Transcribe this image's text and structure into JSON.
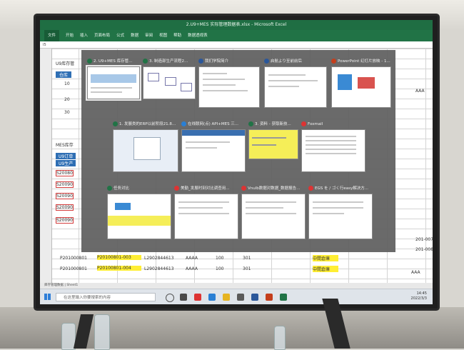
{
  "excel": {
    "title": "2.U9+MES 实际管理数据表.xlsx - Microsoft Excel",
    "ribbon_tabs": [
      "文件",
      "开始",
      "插入",
      "页面布局",
      "公式",
      "数据",
      "审阅",
      "视图",
      "帮助",
      "数据透视表"
    ],
    "cell_ref": "I5",
    "section1": "U9库存管",
    "header_cell": "仓库",
    "col_values": [
      "10",
      "20",
      "30"
    ],
    "section2": "MES库存",
    "u9_labels": [
      "U9订单",
      "U9生产"
    ],
    "red_codes": [
      "S20080",
      "S20090",
      "S20090",
      "S20090",
      "S20090"
    ],
    "right_codes": [
      "201-007",
      "201-008"
    ],
    "aaa": [
      "AAA",
      "AAA"
    ],
    "rows": [
      {
        "code": "P201000801",
        "order": "P20100801-003",
        "lot": "L2902844613",
        "grade": "AAAA",
        "qty": "100",
        "loc": "301",
        "status": "中間倉庫"
      },
      {
        "code": "P201000801",
        "order": "P20100801-004",
        "lot": "L2902844613",
        "grade": "AAAA",
        "qty": "100",
        "loc": "301",
        "status": "中間倉庫"
      }
    ],
    "sheet_tab": "库存管理数据 | Sheet1"
  },
  "switcher": {
    "windows": [
      {
        "label": "2. U9+MES 库存管...",
        "icon": "excel-icon"
      },
      {
        "label": "3. 制造部生产流程2...",
        "icon": "excel-icon"
      },
      {
        "label": "我们学院简介",
        "icon": "word-icon"
      },
      {
        "label": "启航より至前前后",
        "icon": "word-icon"
      },
      {
        "label": "PowerPoint 幻灯片放映 - 1...",
        "icon": "ppt-icon"
      },
      {
        "label": "1. 发展类的ERP以前阶段21.8...",
        "icon": "excel-icon"
      },
      {
        "label": "在线联网(点) API+MES 三...",
        "icon": "edge-icon"
      },
      {
        "label": "3. 资料 - 获取新技...",
        "icon": "excel-icon"
      },
      {
        "label": "Foxmail",
        "icon": "foxmail-icon"
      },
      {
        "label": "任务对比",
        "icon": "excel-icon"
      },
      {
        "label": "美勤_发展时刻对比调查用...",
        "icon": "foxmail-icon"
      },
      {
        "label": "Vnulb数据对数据_数据报告...",
        "icon": "foxmail-icon"
      },
      {
        "label": "EGS を / ゴく行easy解决方...",
        "icon": "foxmail-icon"
      }
    ]
  },
  "taskbar": {
    "search_placeholder": "在这里输入你要搜索的内容",
    "time": "14:45",
    "date": "2022/3/3"
  },
  "colors": {
    "excel_green": "#217346",
    "highlight_yellow": "#ffee33",
    "error_red": "#d43c3c"
  }
}
